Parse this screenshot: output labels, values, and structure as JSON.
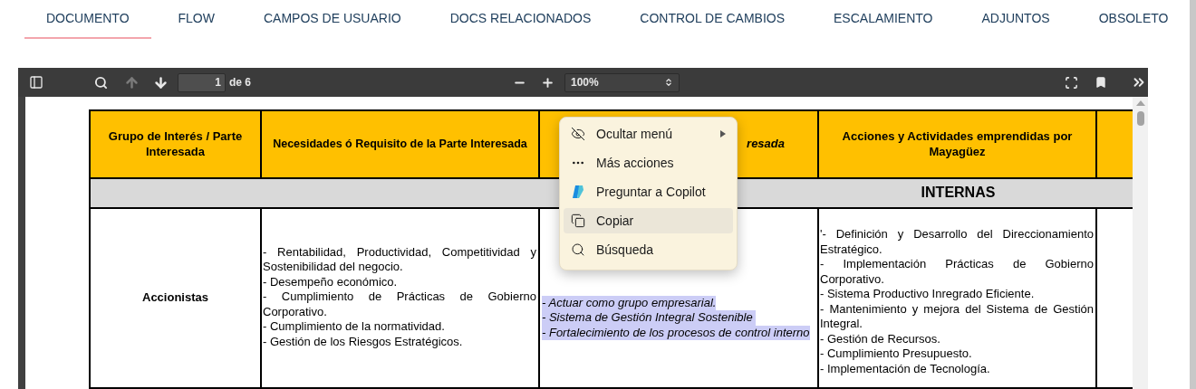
{
  "tabs": [
    {
      "label": "DOCUMENTO",
      "selected": true
    },
    {
      "label": "FLOW",
      "selected": false
    },
    {
      "label": "CAMPOS DE USUARIO",
      "selected": false
    },
    {
      "label": "DOCS RELACIONADOS",
      "selected": false
    },
    {
      "label": "CONTROL DE CAMBIOS",
      "selected": false
    },
    {
      "label": "ESCALAMIENTO",
      "selected": false
    },
    {
      "label": "ADJUNTOS",
      "selected": false
    },
    {
      "label": "OBSOLETO",
      "selected": false
    }
  ],
  "viewer": {
    "toolbar": {
      "page_number": "1",
      "page_count": "de 6",
      "zoom": "100%",
      "previous_disabled": true
    }
  },
  "table": {
    "headers": [
      {
        "text": "Grupo de Interés / Parte Interesada",
        "italic": false
      },
      {
        "text": "Necesidades ó Requisito de la Parte Interesada",
        "italic": false
      },
      {
        "text": "resada",
        "italic": true
      },
      {
        "text": "Acciones y Actividades emprendidas por Mayagüez",
        "italic": false
      }
    ],
    "section": "INTERNAS",
    "rows": [
      {
        "group": "Accionistas",
        "needs": [
          "- Rentabilidad, Productividad, Competitividad y Sostenibilidad del negocio.",
          "- Desempeño económico.",
          "- Cumplimiento de Prácticas de Gobierno Corporativo.",
          "- Cumplimiento de la normatividad.",
          "- Gestión de los Riesgos Estratégicos."
        ],
        "expectations": {
          "selected": true,
          "lines": [
            "- Actuar como grupo empresarial.",
            "- Sistema de Gestión Integral Sostenible ",
            "- Fortalecimiento de los procesos de control interno"
          ]
        },
        "actions": [
          "'- Definición y Desarrollo del Direccionamiento Estratégico.",
          "- Implementación Prácticas de Gobierno Corporativo.",
          "- Sistema Productivo Inregrado Eficiente.",
          "- Mantenimiento y mejora del Sistema de Gestión Integral.",
          "- Gestión de Recursos.",
          "- Cumplimiento Presupuesto.",
          "- Implementación de Tecnología."
        ]
      }
    ]
  },
  "context_menu": [
    {
      "kind": "hide",
      "label": "Ocultar menú",
      "submenu": true,
      "highlighted": false
    },
    {
      "kind": "more",
      "label": "Más acciones",
      "submenu": false,
      "highlighted": false
    },
    {
      "kind": "copilot",
      "label": "Preguntar a Copilot",
      "submenu": false,
      "highlighted": false
    },
    {
      "kind": "copy",
      "label": "Copiar",
      "submenu": false,
      "highlighted": true
    },
    {
      "kind": "search",
      "label": "Búsqueda",
      "submenu": false,
      "highlighted": false
    }
  ]
}
